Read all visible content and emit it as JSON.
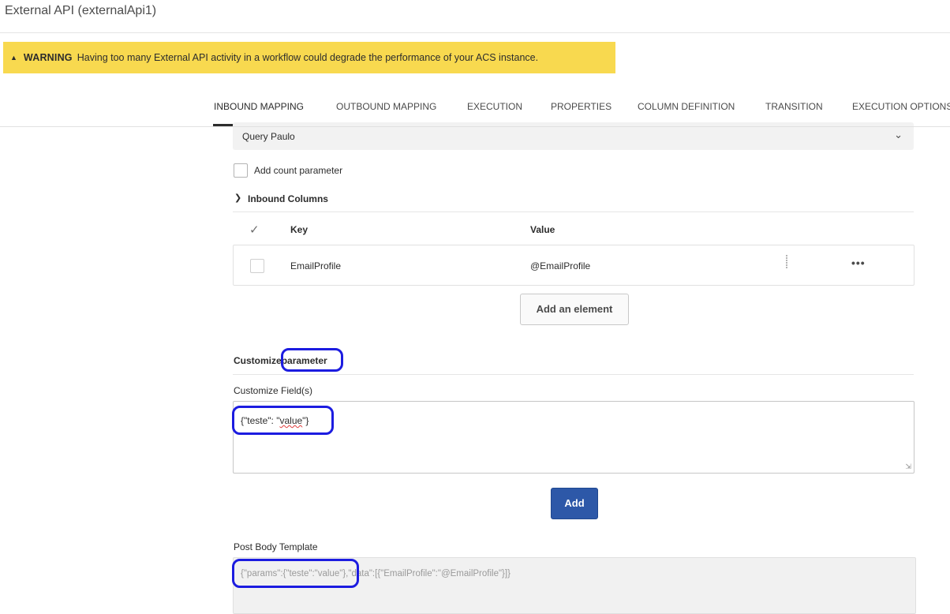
{
  "window": {
    "title": "External API (externalApi1)"
  },
  "warning": {
    "label": "WARNING",
    "message": "Having too many External API activity in a workflow could degrade the performance of your ACS instance."
  },
  "tabs": [
    {
      "label": "INBOUND MAPPING",
      "active": true
    },
    {
      "label": "OUTBOUND MAPPING"
    },
    {
      "label": "EXECUTION"
    },
    {
      "label": "PROPERTIES"
    },
    {
      "label": "COLUMN DEFINITION"
    },
    {
      "label": "TRANSITION"
    },
    {
      "label": "EXECUTION OPTIONS"
    }
  ],
  "query_select": {
    "value": "Query Paulo"
  },
  "add_count_parameter": {
    "label": "Add count parameter",
    "checked": false
  },
  "inbound_columns": {
    "title": "Inbound Columns",
    "headers": {
      "key": "Key",
      "value": "Value"
    },
    "rows": [
      {
        "key": "EmailProfile",
        "value": "@EmailProfile",
        "checked": false
      }
    ],
    "add_label": "Add an element"
  },
  "customize": {
    "section_title_part1": "Customize",
    "section_title_part2": "parameter",
    "field_label": "Customize Field(s)",
    "field_value_prefix": "{\"teste\": \"",
    "field_value_word": "value",
    "field_value_suffix": "\"}",
    "add_label": "Add"
  },
  "post_body": {
    "label": "Post Body Template",
    "value": "{\"params\":{\"teste\":\"value\"},\"data\":[{\"EmailProfile\":\"@EmailProfile\"}]}"
  },
  "colors": {
    "warning_bg": "#f8d94f",
    "primary_button": "#2d58a8",
    "annotation_ring": "#1c1ce0"
  }
}
